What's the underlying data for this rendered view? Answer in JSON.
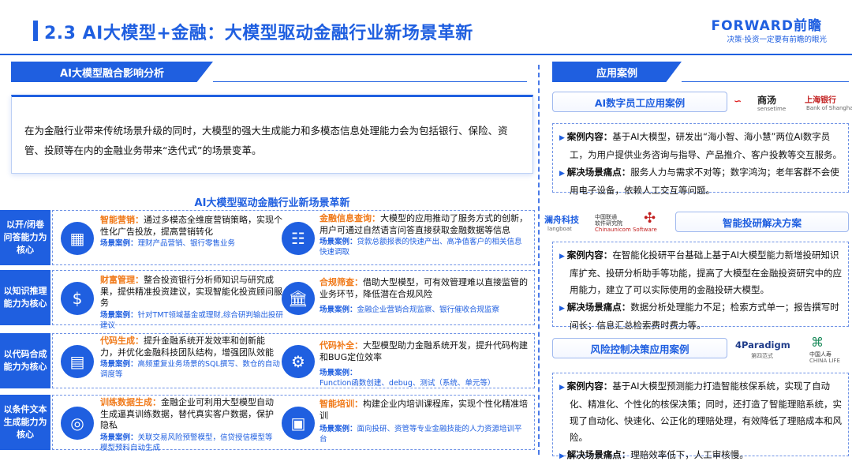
{
  "header": {
    "title": "2.3 AI大模型+金融：大模型驱动金融行业新场景革新",
    "brand": "FORWARD前瞻",
    "brand_sub": "决策·投资一定要有前瞻的眼光"
  },
  "left": {
    "section_title": "AI大模型融合影响分析",
    "intro": "在为金融行业带来传统场景升级的同时，大模型的强大生成能力和多模态信息处理能力会为包括银行、保险、资管、投顾等在内的金融业务带来“迭代式”的场景变革。",
    "grid_title": "AI大模型驱动金融行业新场景革新",
    "scene_label": "场景案例：",
    "rows": [
      {
        "label": "以开/闭卷问答能力为核心",
        "items": [
          {
            "icon": "marketing-icon",
            "title": "智能营销：",
            "desc": "通过多模态全维度营销策略，实现个性化广告投放，提高营销转化",
            "scene": "理财产品营销、银行零售业务"
          },
          {
            "icon": "presentation-icon",
            "title": "金融信息查询：",
            "desc": "大模型的应用推动了服务方式的创新，用户可通过自然语言问答直接获取金融数据等信息",
            "scene": "贷款总额报表的快速产出、高净值客户的相关信息快速调取"
          }
        ]
      },
      {
        "label": "以知识推理能力为核心",
        "items": [
          {
            "icon": "money-bag-icon",
            "title": "财富管理：",
            "desc": "整合投资银行分析师知识与研究成果，提供精准投资建议，实现智能化投资顾问服务",
            "scene": "针对TMT领域基金或理财,综合研判输出投研建议"
          },
          {
            "icon": "bank-icon",
            "title": "合规筛查：",
            "desc": "借助大型模型，可有效管理难以直接监管的业务环节，降低潜在合规风险",
            "scene": "金融企业营销合规监察、银行催收合规监察"
          }
        ]
      },
      {
        "label": "以代码合成能力为核心",
        "items": [
          {
            "icon": "code-icon",
            "title": "代码生成：",
            "desc": "提升金融系统开发效率和创新能力，并优化金融科技团队结构，增强团队效能",
            "scene": "高频重复业务场景的SQL撰写、数仓的自动调度等"
          },
          {
            "icon": "code-patch-icon",
            "title": "代码补全：",
            "desc": "大型模型助力金融系统开发，提升代码构建和BUG定位效率",
            "scene": "Function函数创建、debug、测试（系统、单元等）"
          }
        ]
      },
      {
        "label": "以条件文本生成能力为核心",
        "items": [
          {
            "icon": "network-icon",
            "title": "训练数据生成：",
            "desc": "金融企业可利用大型模型自动生成逼真训练数据，替代真实客户数据，保护隐私",
            "scene": "关联交易风险预警模型，信贷授信模型等模型预料自动生成"
          },
          {
            "icon": "training-icon",
            "title": "智能培训：",
            "desc": "构建企业内培训课程库，实现个性化精准培训",
            "scene": "面向投研、资管等专业金融技能的人力资源培训平台"
          }
        ]
      }
    ]
  },
  "right": {
    "section_title": "应用案例",
    "case_label": "案例内容：",
    "pain_label": "解决场景痛点：",
    "cases": [
      {
        "title": "AI数字员工应用案例",
        "logos": [
          "商汤",
          "sensetime",
          "上海银行",
          "Bank of Shanghai"
        ],
        "content": "基于AI大模型，研发出“海小智、海小慧”两位AI数字员工，为用户提供业务咨询与指导、产品推介、客户投教等交互服务。",
        "pain": "服务人力与需求不对等；数字鸿沟；老年客群不会使用电子设备，依赖人工交互等问题。"
      },
      {
        "title": "智能投研解决方案",
        "logos": [
          "澜舟科技",
          "langboat",
          "中国联通",
          "软件研究院",
          "Chinaunicom Software"
        ],
        "content": "在智能化投研平台基础上基于AI大模型能力新增投研知识库扩充、投研分析助手等功能，提高了大模型在金融投资研究中的应用能力，建立了可以实际使用的金融投研大模型。",
        "pain": "数据分析处理能力不足；检索方式单一；报告撰写时间长；信息汇总检索费时费力等。"
      },
      {
        "title": "风险控制决策应用案例",
        "logos": [
          "4Paradigm",
          "第四范式",
          "中国人寿",
          "CHINA LIFE"
        ],
        "content": "基于AI大模型预测能力打造智能核保系统，实现了自动化、精准化、个性化的核保决策；同时，还打造了智能理赔系统，实现了自动化、快速化、公正化的理赔处理，有效降低了理赔成本和风险。",
        "pain": "理赔效率低下，人工审核慢。"
      }
    ]
  },
  "colors": {
    "primary": "#1f5fe0",
    "accent": "#f07a1a"
  }
}
